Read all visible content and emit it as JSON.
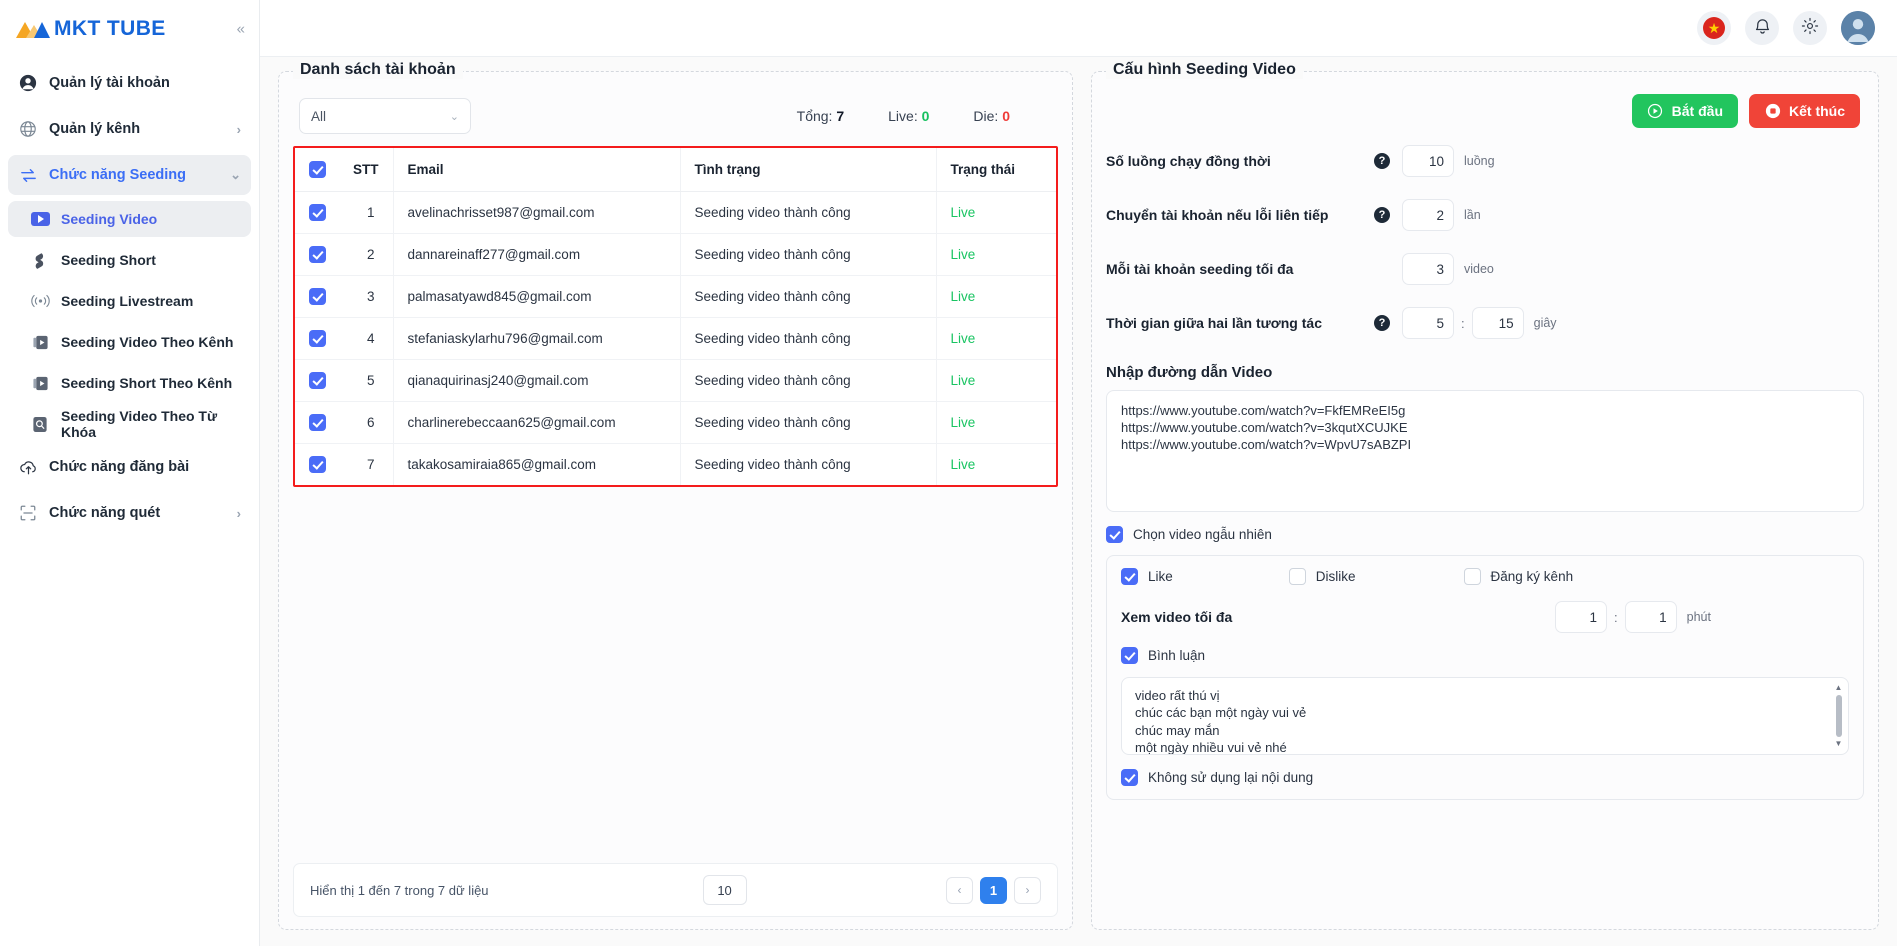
{
  "brand": {
    "name": "MKT TUBE",
    "collapse_icon": "chevron-left-double"
  },
  "sidebar": {
    "items": [
      {
        "label": "Quản lý tài khoản",
        "icon": "user-circle-icon",
        "chevron": ""
      },
      {
        "label": "Quản lý kênh",
        "icon": "globe-icon",
        "chevron": "›"
      },
      {
        "label": "Chức năng Seeding",
        "icon": "transfer-icon",
        "chevron": "⌄"
      }
    ],
    "sub_items": [
      {
        "label": "Seeding Video",
        "icon": "youtube-play-icon"
      },
      {
        "label": "Seeding Short",
        "icon": "shorts-icon"
      },
      {
        "label": "Seeding Livestream",
        "icon": "livestream-icon"
      },
      {
        "label": "Seeding Video Theo Kênh",
        "icon": "video-channel-icon"
      },
      {
        "label": "Seeding Short Theo Kênh",
        "icon": "short-channel-icon"
      },
      {
        "label": "Seeding Video Theo Từ Khóa",
        "icon": "keyword-search-icon"
      }
    ],
    "bottom_items": [
      {
        "label": "Chức năng đăng bài",
        "icon": "cloud-upload-icon",
        "chevron": ""
      },
      {
        "label": "Chức năng quét",
        "icon": "scan-icon",
        "chevron": "›"
      }
    ]
  },
  "topbar": {
    "flag_icon": "vietnam-flag-icon",
    "bell_icon": "bell-icon",
    "gear_icon": "gear-icon",
    "avatar_icon": "user-avatar"
  },
  "accounts_panel": {
    "title": "Danh sách tài khoản",
    "filter_value": "All",
    "total_label": "Tổng:",
    "total_value": "7",
    "live_label": "Live:",
    "live_value": "0",
    "die_label": "Die:",
    "die_value": "0",
    "columns": [
      "STT",
      "Email",
      "Tình trạng",
      "Trạng thái"
    ],
    "rows": [
      {
        "stt": "1",
        "email": "avelinachrisset987@gmail.com",
        "tinh_trang": "Seeding video thành công",
        "trang_thai": "Live",
        "checked": true
      },
      {
        "stt": "2",
        "email": "dannareinaff277@gmail.com",
        "tinh_trang": "Seeding video thành công",
        "trang_thai": "Live",
        "checked": true
      },
      {
        "stt": "3",
        "email": "palmasatyawd845@gmail.com",
        "tinh_trang": "Seeding video thành công",
        "trang_thai": "Live",
        "checked": true
      },
      {
        "stt": "4",
        "email": "stefaniaskylarhu796@gmail.com",
        "tinh_trang": "Seeding video thành công",
        "trang_thai": "Live",
        "checked": true
      },
      {
        "stt": "5",
        "email": "qianaquirinasj240@gmail.com",
        "tinh_trang": "Seeding video thành công",
        "trang_thai": "Live",
        "checked": true
      },
      {
        "stt": "6",
        "email": "charlinerebeccaan625@gmail.com",
        "tinh_trang": "Seeding video thành công",
        "trang_thai": "Live",
        "checked": true
      },
      {
        "stt": "7",
        "email": "takakosamiraia865@gmail.com",
        "tinh_trang": "Seeding video thành công",
        "trang_thai": "Live",
        "checked": true
      }
    ],
    "footer_info": "Hiển thị 1 đến 7 trong 7 dữ liệu",
    "page_size": "10",
    "page_current": "1",
    "prev_icon": "chevron-left-icon",
    "next_icon": "chevron-right-icon"
  },
  "config_panel": {
    "title": "Cấu hình Seeding Video",
    "start_button": "Bắt đầu",
    "stop_button": "Kết thúc",
    "rows": [
      {
        "label": "Số luồng chạy đồng thời",
        "help": true,
        "value": "10",
        "unit": "luồng"
      },
      {
        "label": "Chuyển tài khoản nếu lỗi liên tiếp",
        "help": true,
        "value": "2",
        "unit": "lần"
      },
      {
        "label": "Mỗi tài khoản seeding tối đa",
        "help": false,
        "value": "3",
        "unit": "video"
      },
      {
        "label": "Thời gian giữa hai lần tương tác",
        "help": true,
        "value": "5",
        "value2": "15",
        "unit": "giây"
      }
    ],
    "url_section_title": "Nhập đường dẫn Video",
    "urls": [
      "https://www.youtube.com/watch?v=FkfEMReEI5g",
      "https://www.youtube.com/watch?v=3kqutXCUJKE",
      "https://www.youtube.com/watch?v=WpvU7sABZPI"
    ],
    "random_video_label": "Chọn video ngẫu nhiên",
    "random_video_checked": true,
    "options": [
      {
        "label": "Like",
        "checked": true
      },
      {
        "label": "Dislike",
        "checked": false
      },
      {
        "label": "Đăng ký kênh",
        "checked": false
      }
    ],
    "watch_label": "Xem video tối đa",
    "watch_min": "1",
    "watch_max": "1",
    "watch_unit": "phút",
    "comment_label": "Bình luận",
    "comment_checked": true,
    "comments": [
      "video rất thú vị",
      "chúc các bạn một ngày vui vẻ",
      "chúc may mắn",
      "một ngày nhiều vui vẻ nhé"
    ],
    "no_reuse_label": "Không sử dụng lại nội dung",
    "no_reuse_checked": true
  }
}
